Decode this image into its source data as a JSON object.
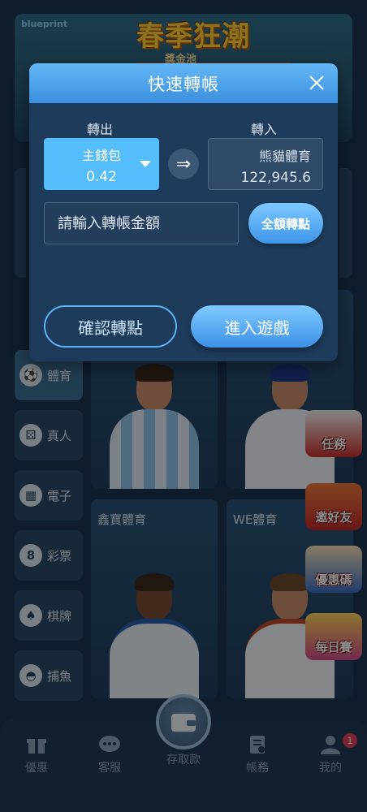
{
  "banner": {
    "brand": "blueprint",
    "title": "春季狂潮",
    "subtitle": "獎金池"
  },
  "side_menu": [
    {
      "label": "體育",
      "icon": "soccer-ball-icon",
      "active": true
    },
    {
      "label": "真人",
      "icon": "dice-icon",
      "active": false
    },
    {
      "label": "電子",
      "icon": "slot-machine-icon",
      "active": false
    },
    {
      "label": "彩票",
      "icon": "lottery-ball-icon",
      "active": false
    },
    {
      "label": "棋牌",
      "icon": "cards-icon",
      "active": false
    },
    {
      "label": "捕魚",
      "icon": "fish-icon",
      "active": false
    }
  ],
  "games": [
    {
      "label": ""
    },
    {
      "label": ""
    },
    {
      "label": "鑫寶體育"
    },
    {
      "label": "WE體育"
    }
  ],
  "promos": [
    {
      "label": "任務"
    },
    {
      "label": "邀好友"
    },
    {
      "label": "優惠碼"
    },
    {
      "label": "每日賽"
    }
  ],
  "bottom_nav": {
    "items": [
      {
        "label": "優惠",
        "icon": "gift-icon"
      },
      {
        "label": "客服",
        "icon": "chat-icon"
      },
      {
        "label": "存取款",
        "icon": "wallet-icon"
      },
      {
        "label": "帳務",
        "icon": "ledger-icon"
      },
      {
        "label": "我的",
        "icon": "user-icon"
      }
    ],
    "notification_count": "1"
  },
  "modal": {
    "title": "快速轉帳",
    "from_label": "轉出",
    "to_label": "轉入",
    "from_wallet": {
      "name": "主錢包",
      "balance": "0.42"
    },
    "to_wallet": {
      "name": "熊貓體育",
      "balance": "122,945.6"
    },
    "swap_symbol": "⇒",
    "amount_placeholder": "請輸入轉帳金額",
    "all_button": "全額轉點",
    "confirm_button": "確認轉點",
    "enter_button": "進入遊戲"
  },
  "colors": {
    "accent": "#55bdf9",
    "header_gradient_top": "#64b8f6",
    "modal_bg": "#1d3b5b",
    "badge": "#e0435b"
  }
}
